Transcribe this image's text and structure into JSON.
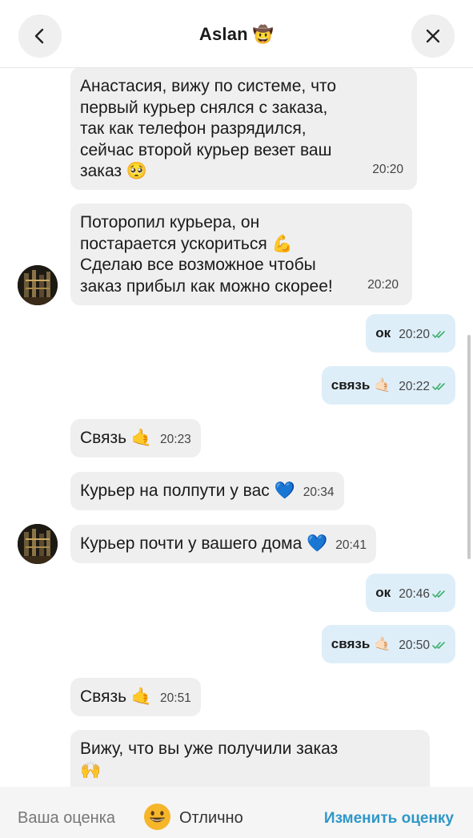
{
  "header": {
    "title": "Aslan",
    "title_emoji": "🤠"
  },
  "messages": [
    {
      "dir": "in",
      "text": "Анастасия, вижу по системе, что\nпервый курьер снялся с заказа,\nтак как телефон разрядился,\nсейчас второй курьер везет ваш\nзаказ 🥺",
      "time": "20:20"
    },
    {
      "dir": "in",
      "text": "Поторопил курьера, он\nпостарается ускориться 💪\nСделаю все возможное чтобы\nзаказ прибыл как можно скорее!",
      "time": "20:20"
    },
    {
      "dir": "out",
      "text": "ок",
      "time": "20:20"
    },
    {
      "dir": "out",
      "text": "связь 🤙🏻",
      "time": "20:22"
    },
    {
      "dir": "in",
      "text": "Связь 🤙",
      "time": "20:23"
    },
    {
      "dir": "in",
      "text": "Курьер на полпути у вас 💙",
      "time": "20:34"
    },
    {
      "dir": "in",
      "text": "Курьер почти у вашего дома 💙",
      "time": "20:41"
    },
    {
      "dir": "out",
      "text": "ок",
      "time": "20:46"
    },
    {
      "dir": "out",
      "text": "связь 🤙🏻",
      "time": "20:50"
    },
    {
      "dir": "in",
      "text": "Связь 🤙",
      "time": "20:51"
    },
    {
      "dir": "in",
      "text": "Вижу, что вы уже получили заказ\n🙌",
      "time": ""
    }
  ],
  "footer": {
    "rating_label": "Ваша оценка",
    "rating_value": "Отлично",
    "change_label": "Изменить оценку"
  },
  "colors": {
    "incoming_bubble": "#efefef",
    "outgoing_bubble": "#deeef9",
    "read_check": "#3fb06a",
    "accent_link": "#2f97c7"
  }
}
